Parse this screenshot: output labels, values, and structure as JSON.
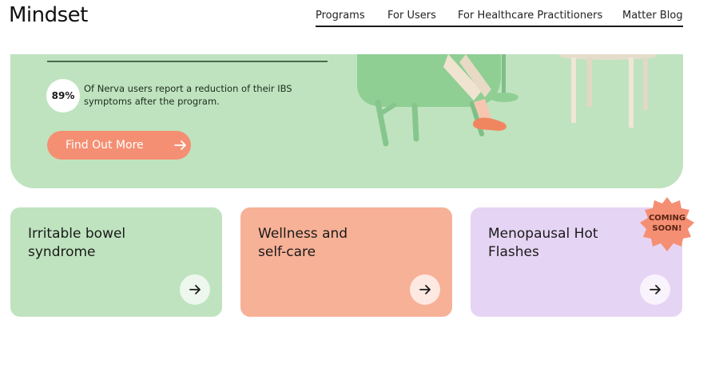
{
  "header": {
    "logo": "Mindset",
    "nav": [
      {
        "label": "Programs"
      },
      {
        "label": "For Users"
      },
      {
        "label": "For Healthcare Practitioners"
      },
      {
        "label": "Matter Blog"
      }
    ]
  },
  "hero": {
    "stat_value": "89%",
    "stat_text": "Of Nerva users report a reduction of their IBS symptoms after the program.",
    "cta_label": "Find Out More",
    "cta_icon": "arrow-right-icon"
  },
  "cards": [
    {
      "title_line1": "Irritable bowel",
      "title_line2": "syndrome",
      "icon": "arrow-right-icon",
      "color": "#bfe3bf"
    },
    {
      "title_line1": "Wellness and",
      "title_line2": "self-care",
      "icon": "arrow-right-icon",
      "color": "#f7b197"
    },
    {
      "title_line1": "Menopausal Hot",
      "title_line2": "Flashes",
      "icon": "arrow-right-icon",
      "color": "#e6d4f4"
    }
  ],
  "badge": {
    "line1": "COMING",
    "line2": "SOON!",
    "color": "#f58f73"
  },
  "colors": {
    "accent": "#f58f73",
    "hero_bg": "#bfe3bf"
  }
}
